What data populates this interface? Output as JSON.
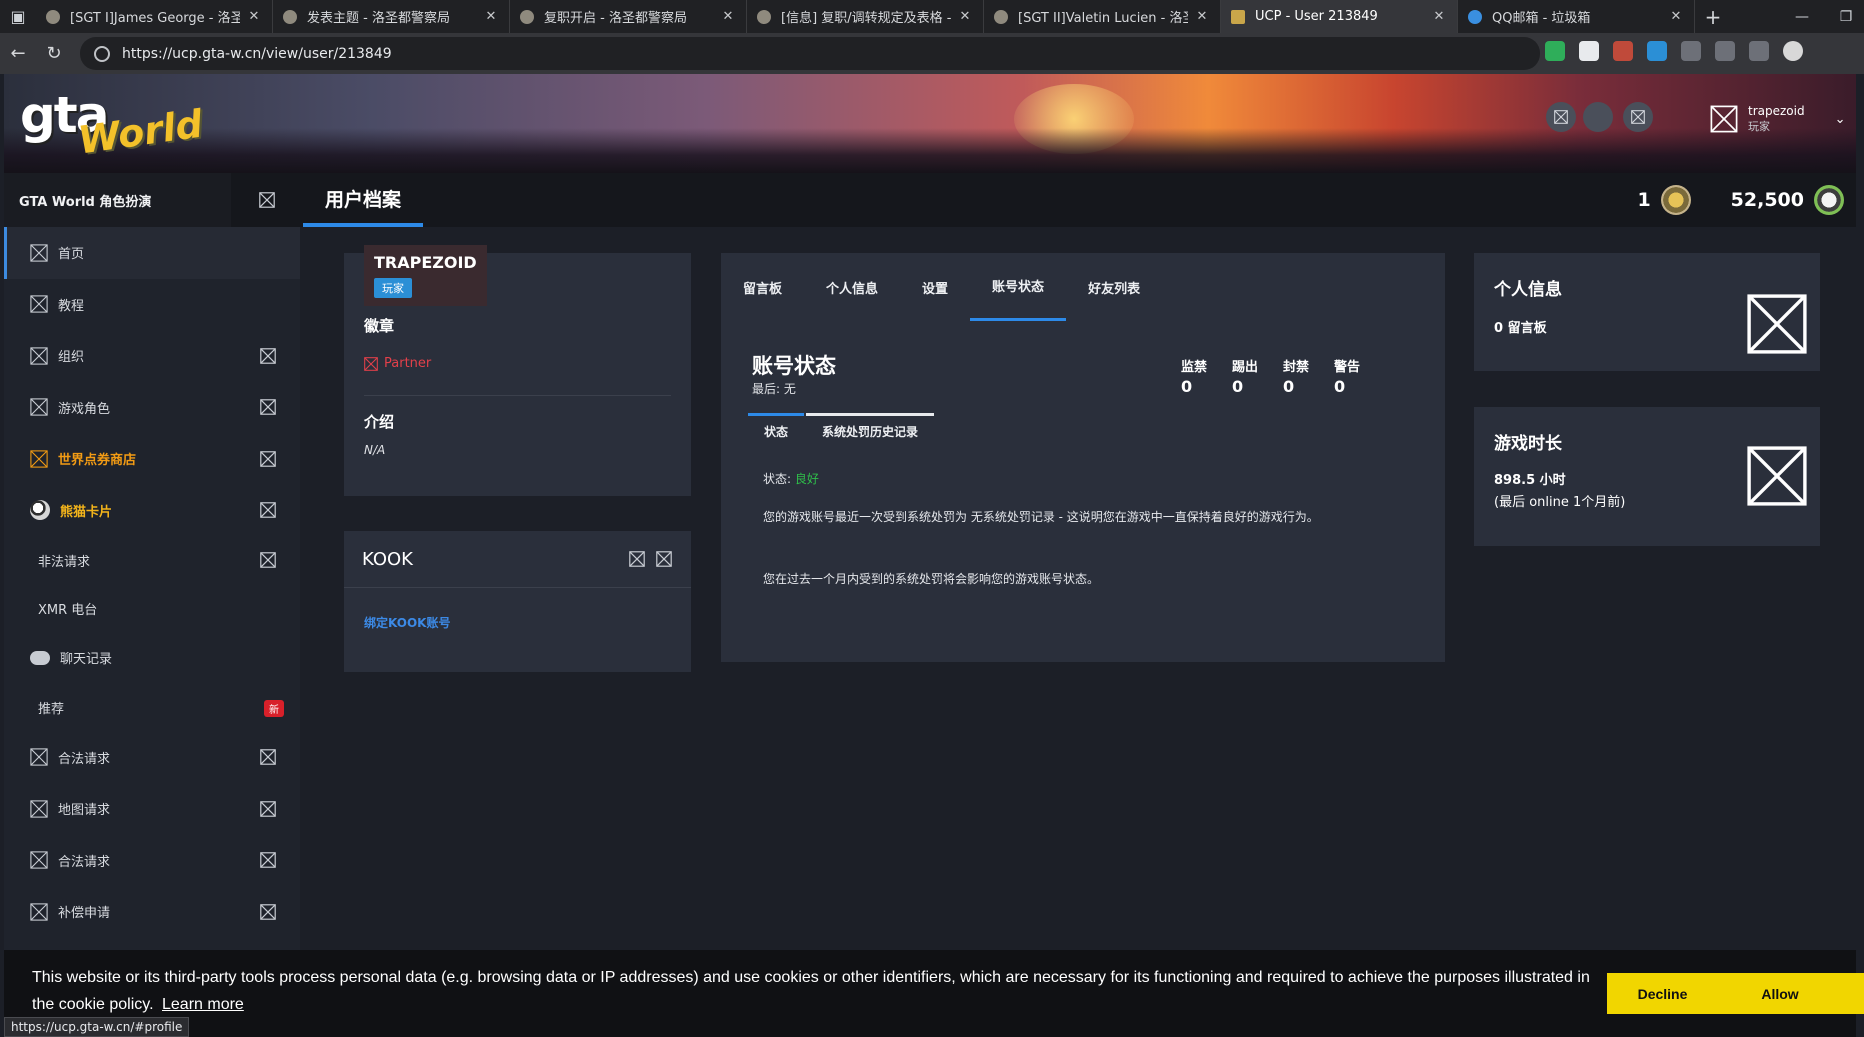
{
  "browser": {
    "tabs": [
      {
        "title": "[SGT I]James George - 洛圣都警"
      },
      {
        "title": "发表主题 - 洛圣都警察局"
      },
      {
        "title": "复职开启 - 洛圣都警察局"
      },
      {
        "title": "[信息] 复职/调转规定及表格 - 洛"
      },
      {
        "title": "[SGT II]Valetin Lucien - 洛圣都警"
      },
      {
        "title": "UCP - User 213849"
      },
      {
        "title": "QQ邮箱 - 垃圾箱"
      }
    ],
    "active_tab_index": 5,
    "url": "https://ucp.gta-w.cn/view/user/213849",
    "status_url": "https://ucp.gta-w.cn/#profile"
  },
  "header": {
    "logo_gta": "gta",
    "logo_world": "World",
    "username": "trapezoid",
    "role": "玩家"
  },
  "topbar": {
    "brand": "GTA World 角色扮演",
    "page_title": "用户档案",
    "level": "1",
    "points": "52,500"
  },
  "sidebar": {
    "items": [
      {
        "label": "首页"
      },
      {
        "label": "教程"
      },
      {
        "label": "组织"
      },
      {
        "label": "游戏角色"
      },
      {
        "label": "世界点券商店"
      },
      {
        "label": "熊猫卡片"
      },
      {
        "label": "非法请求"
      },
      {
        "label": "XMR 电台"
      },
      {
        "label": "聊天记录"
      },
      {
        "label": "推荐",
        "badge": "新"
      },
      {
        "label": "合法请求"
      },
      {
        "label": "地图请求"
      },
      {
        "label": "合法请求"
      },
      {
        "label": "补偿申请"
      }
    ]
  },
  "profile": {
    "name": "TRAPEZOID",
    "role_badge": "玩家",
    "badges_heading": "徽章",
    "partner_label": "Partner",
    "intro_heading": "介绍",
    "intro_value": "N/A"
  },
  "kook": {
    "title": "KOOK",
    "link_label": "绑定KOOK账号"
  },
  "status": {
    "tabs": [
      "留言板",
      "个人信息",
      "设置",
      "账号状态",
      "好友列表"
    ],
    "active_tab": 3,
    "title": "账号状态",
    "last": "最后: 无",
    "stats": [
      {
        "label": "监禁",
        "value": "0"
      },
      {
        "label": "踢出",
        "value": "0"
      },
      {
        "label": "封禁",
        "value": "0"
      },
      {
        "label": "警告",
        "value": "0"
      }
    ],
    "subtabs": [
      "状态",
      "系统处罚历史记录"
    ],
    "status_label": "状态: ",
    "status_value": "良好",
    "paragraph1": "您的游戏账号最近一次受到系统处罚为 无系统处罚记录 - 这说明您在游戏中一直保持着良好的游戏行为。",
    "paragraph2": "您在过去一个月内受到的系统处罚将会影响您的游戏账号状态。"
  },
  "right_cards": {
    "info_title": "个人信息",
    "info_value": "0 留言板",
    "playtime_title": "游戏时长",
    "playtime_value": "898.5 小时",
    "playtime_sub": "(最后 online 1个月前)"
  },
  "cookie": {
    "text": "This website or its third-party tools process personal data (e.g. browsing data or IP addresses) and use cookies or other identifiers, which are necessary for its functioning and required to achieve the purposes illustrated in the cookie policy.",
    "learn_more": "Learn more",
    "decline": "Decline",
    "allow": "Allow"
  },
  "colors": {
    "accent": "#2d8ae8",
    "status_good": "#2fbf4a",
    "cookie_button": "#f1d600",
    "partner": "#e2404a",
    "shop_orange": "#f29b14"
  }
}
